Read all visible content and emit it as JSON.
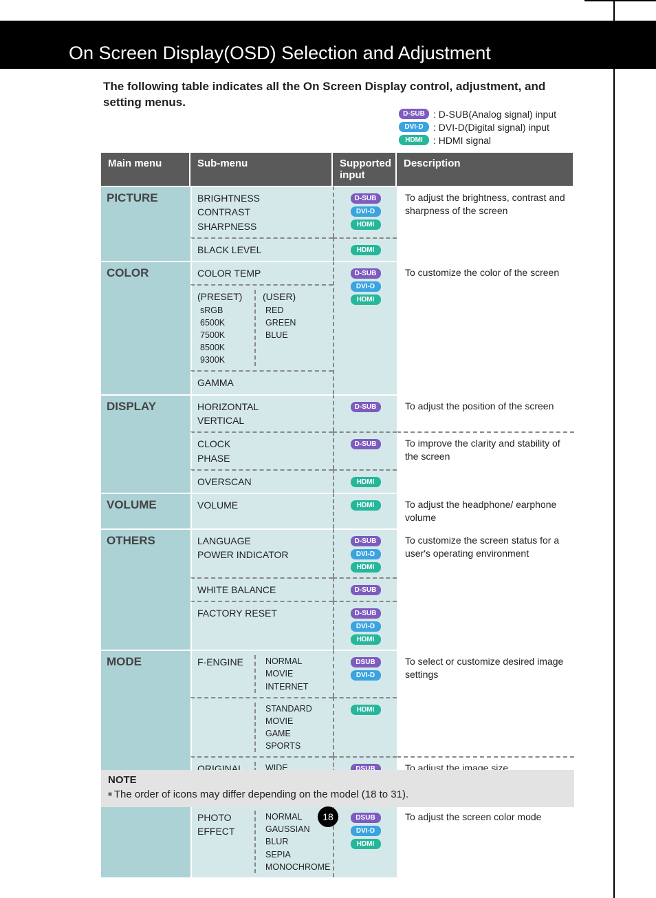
{
  "page_title": "On Screen Display(OSD) Selection and Adjustment",
  "intro": "The following table indicates all the On Screen Display control, adjustment, and setting menus.",
  "legend": {
    "dsub": {
      "badge": "D-SUB",
      "text": ": D-SUB(Analog signal) input"
    },
    "dvid": {
      "badge": "DVI-D",
      "text": ": DVI-D(Digital signal) input"
    },
    "hdmi": {
      "badge": "HDMI",
      "text": ": HDMI signal"
    }
  },
  "headers": {
    "main": "Main menu",
    "sub": "Sub-menu",
    "input": "Supported input",
    "desc": "Description"
  },
  "badges": {
    "dsub": "D-SUB",
    "dsub2": "DSUB",
    "dvid": "DVI-D",
    "hdmi": "HDMI"
  },
  "rows": {
    "picture": {
      "main": "PICTURE",
      "sub1": "BRIGHTNESS\nCONTRAST\nSHARPNESS",
      "sub2": "BLACK LEVEL",
      "desc": "To adjust the brightness, contrast and sharpness of the screen"
    },
    "color": {
      "main": "COLOR",
      "ct": "COLOR TEMP",
      "preset_h": "(PRESET)",
      "preset": "sRGB\n6500K\n7500K\n8500K\n9300K",
      "user_h": "(USER)",
      "user": "RED\nGREEN\nBLUE",
      "gamma": "GAMMA",
      "desc": "To customize the color of the screen"
    },
    "display": {
      "main": "DISPLAY",
      "sub1": "HORIZONTAL\nVERTICAL",
      "sub2": "CLOCK\nPHASE",
      "sub3": "OVERSCAN",
      "desc1": "To adjust the position of the screen",
      "desc2": "To improve the clarity and stability of the screen"
    },
    "volume": {
      "main": "VOLUME",
      "sub": "VOLUME",
      "desc": "To adjust the headphone/ earphone volume"
    },
    "others": {
      "main": "OTHERS",
      "sub1": "LANGUAGE\nPOWER INDICATOR",
      "sub2": "WHITE BALANCE",
      "sub3": "FACTORY RESET",
      "desc": "To customize the screen status for a user's operating environment"
    },
    "mode": {
      "main": "MODE",
      "fe": "F-ENGINE",
      "fe_a": "NORMAL\nMOVIE\nINTERNET",
      "fe_b": "STANDARD\nMOVIE\nGAME\nSPORTS",
      "desc1": "To select or customize desired image settings",
      "or": "ORIGINAL RATIO",
      "or_v": "WIDE\nORIGINAL",
      "desc2": "To adjust the image size",
      "pe": "PHOTO EFFECT",
      "pe_v": "NORMAL\nGAUSSIAN BLUR\nSEPIA\nMONOCHROME",
      "desc3": "To adjust the screen color mode"
    }
  },
  "note": {
    "title": "NOTE",
    "text": "The order of icons may differ depending on the model (18 to 31)."
  },
  "page_number": "18"
}
